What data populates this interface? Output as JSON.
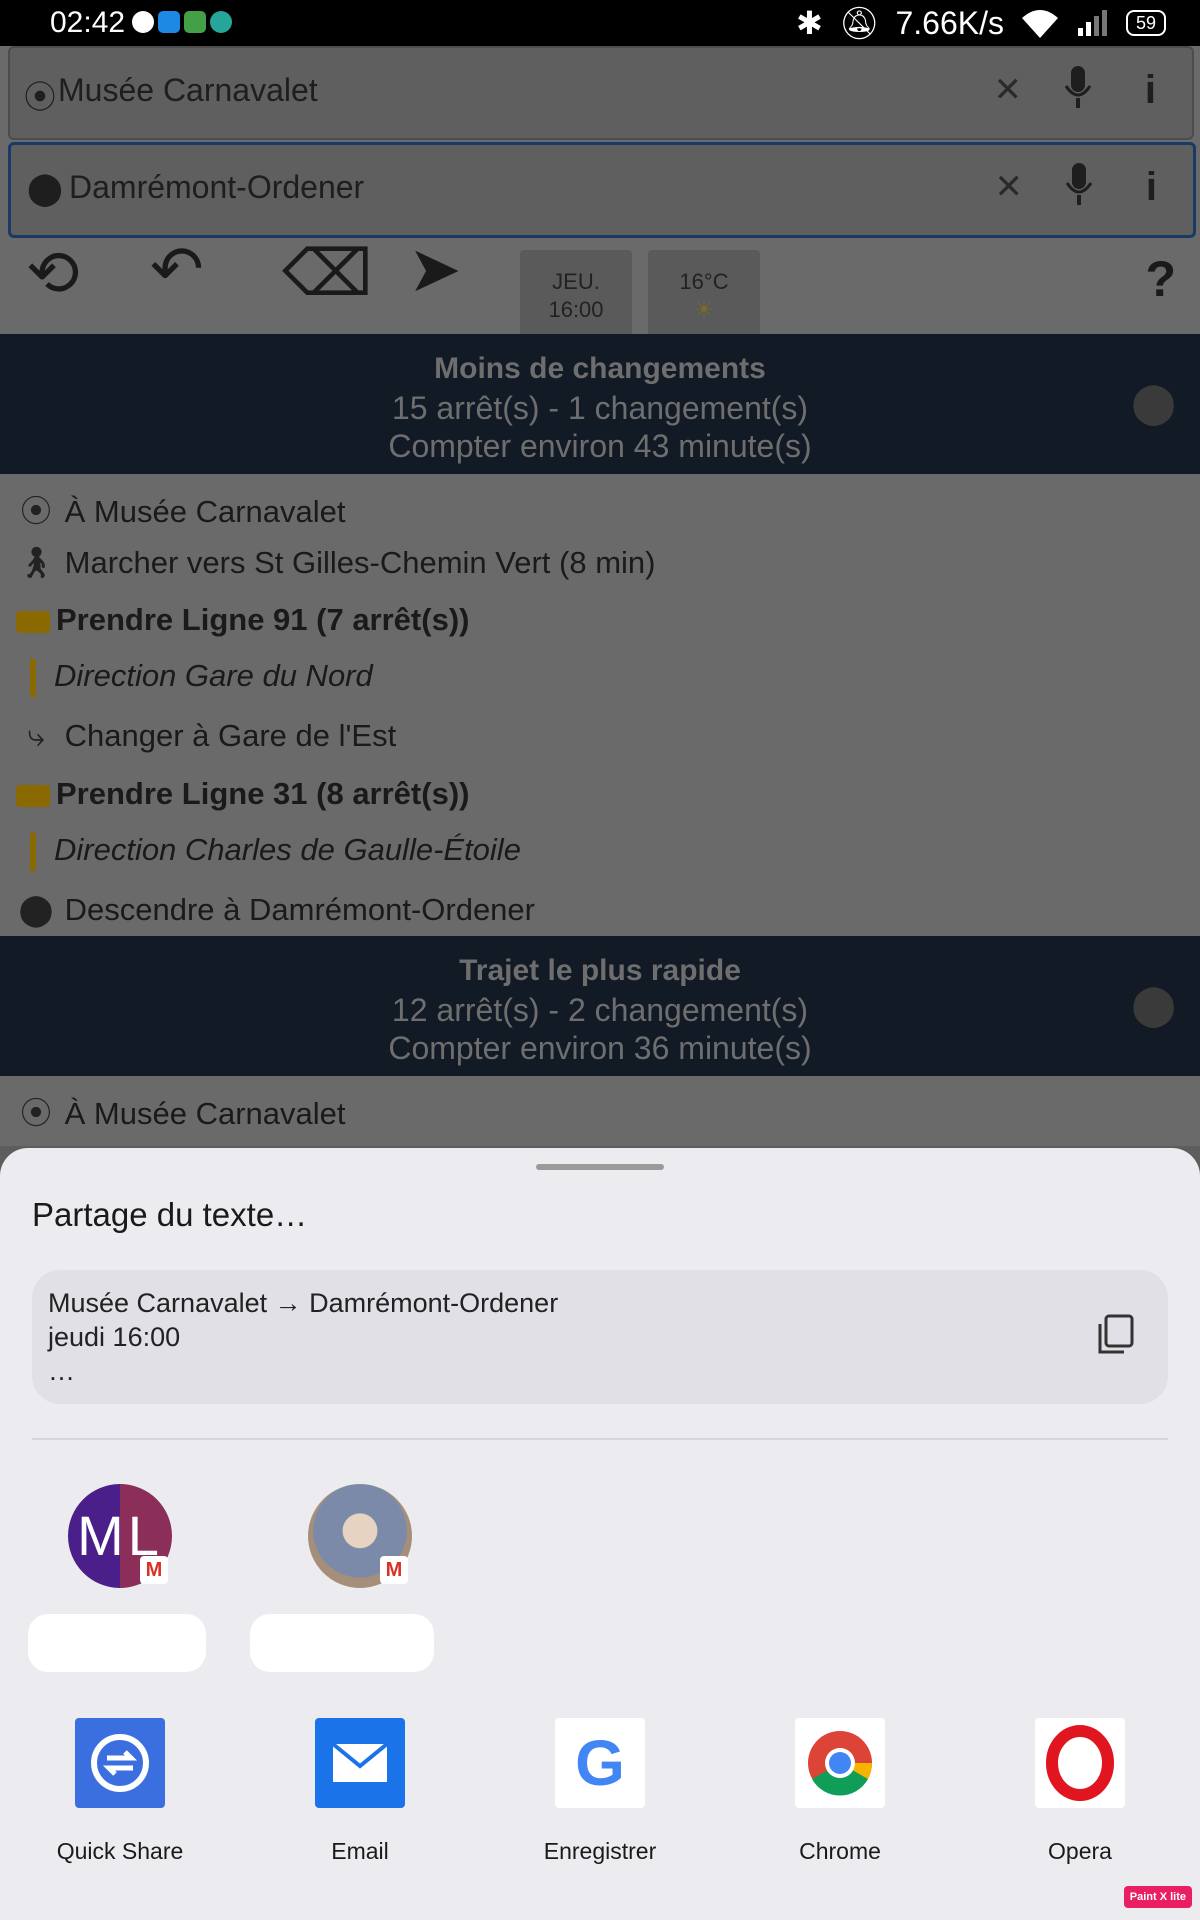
{
  "status_bar": {
    "time": "02:42",
    "network_speed": "7.66K/s",
    "battery": "59"
  },
  "app": {
    "origin_field": {
      "value": "Musée Carnavalet"
    },
    "destination_field": {
      "value": "Damrémont-Ordener"
    },
    "day_chip": {
      "day": "JEU.",
      "time": "16:00"
    },
    "weather_chip": {
      "temp": "16°C"
    },
    "route1": {
      "title": "Moins de changements",
      "summary": "15 arrêt(s) - 1 changement(s)",
      "duration": "Compter environ 43 minute(s)",
      "steps": [
        "À Musée Carnavalet",
        "Marcher vers St Gilles-Chemin Vert (8 min)",
        "Prendre Ligne 91 (7 arrêt(s))",
        "Direction Gare du Nord",
        "Changer à Gare de l'Est",
        "Prendre Ligne 31 (8 arrêt(s))",
        "Direction Charles de Gaulle-Étoile",
        "Descendre à Damrémont-Ordener"
      ]
    },
    "route2": {
      "title": "Trajet le plus rapide",
      "summary": "12 arrêt(s) - 2 changement(s)",
      "duration": "Compter environ 36 minute(s)",
      "steps": [
        "À Musée Carnavalet"
      ]
    }
  },
  "share_sheet": {
    "title": "Partage du texte…",
    "preview_lines": [
      "Musée Carnavalet → Damrémont-Ordener",
      "jeudi 16:00",
      "…"
    ],
    "contacts": [
      {
        "initials": "ML"
      },
      {
        "initials": ""
      }
    ],
    "apps": [
      {
        "label": "Quick Share",
        "color": "#3b6fe0"
      },
      {
        "label": "Email",
        "color": "#1a73e8"
      },
      {
        "label": "Enregistrer",
        "color": "#ffffff"
      },
      {
        "label": "Chrome",
        "color": "#ffffff"
      },
      {
        "label": "Opera",
        "color": "#ffffff"
      }
    ]
  },
  "watermark": "Paint X lite"
}
